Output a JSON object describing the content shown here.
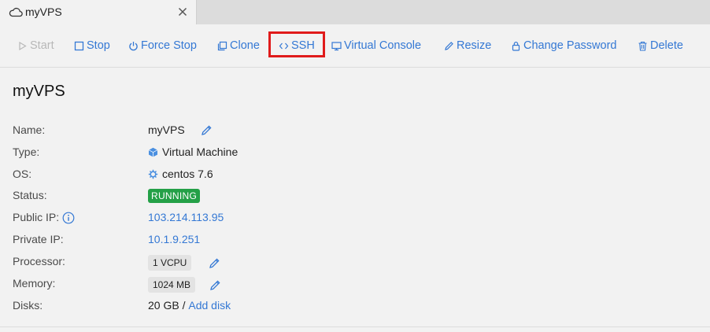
{
  "tab": {
    "title": "myVPS"
  },
  "toolbar": {
    "start": "Start",
    "stop": "Stop",
    "force_stop": "Force Stop",
    "clone": "Clone",
    "ssh": "SSH",
    "virtual_console": "Virtual Console",
    "resize": "Resize",
    "change_password": "Change Password",
    "delete": "Delete"
  },
  "panel": {
    "title": "myVPS"
  },
  "details": {
    "name": {
      "label": "Name:",
      "value": "myVPS"
    },
    "type": {
      "label": "Type:",
      "value": "Virtual Machine"
    },
    "os": {
      "label": "OS:",
      "value": "centos 7.6"
    },
    "status": {
      "label": "Status:",
      "value": "RUNNING"
    },
    "public_ip": {
      "label": "Public IP:",
      "value": "103.214.113.95"
    },
    "private_ip": {
      "label": "Private IP:",
      "value": "10.1.9.251"
    },
    "processor": {
      "label": "Processor:",
      "value": "1 VCPU"
    },
    "memory": {
      "label": "Memory:",
      "value": "1024 MB"
    },
    "disks": {
      "label": "Disks:",
      "value": "20 GB",
      "separator": " / ",
      "add": "Add disk"
    }
  },
  "colors": {
    "accent": "#3478d4",
    "running": "#24a047",
    "highlight": "#e01b1b",
    "disabled": "#b8b8b8"
  },
  "icons": [
    "cloud-icon",
    "close-icon",
    "play-icon",
    "stop-icon",
    "power-icon",
    "clone-icon",
    "code-icon",
    "monitor-icon",
    "pencil-icon",
    "lock-icon",
    "trash-icon",
    "cube-icon",
    "gear-icon",
    "info-icon"
  ]
}
